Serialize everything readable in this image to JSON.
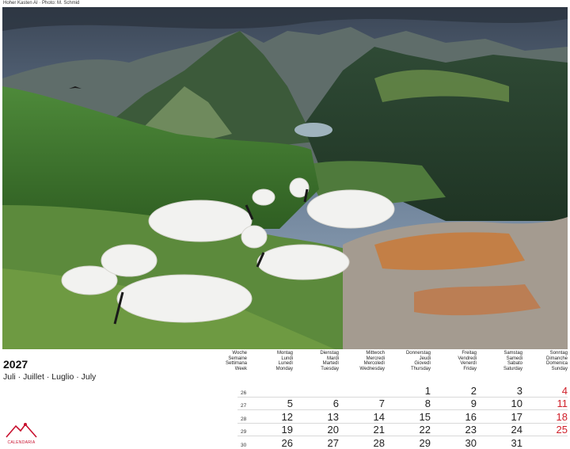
{
  "caption": "Hoher Kasten AI · Photo: M. Schmid",
  "year": "2027",
  "month": "Juli · Juillet · Luglio · July",
  "logo": "CALENDARIA",
  "weekHeader": [
    "Woche",
    "Semaine",
    "Settimana",
    "Week"
  ],
  "dayHeaders": [
    [
      "Montag",
      "Lundi",
      "Lunedì",
      "Monday"
    ],
    [
      "Dienstag",
      "Mardi",
      "Martedì",
      "Tuesday"
    ],
    [
      "Mittwoch",
      "Mercredi",
      "Mercoledì",
      "Wednesday"
    ],
    [
      "Donnerstag",
      "Jeudi",
      "Giovedì",
      "Thursday"
    ],
    [
      "Freitag",
      "Vendredi",
      "Venerdì",
      "Friday"
    ],
    [
      "Samstag",
      "Samedi",
      "Sabato",
      "Saturday"
    ],
    [
      "Sonntag",
      "Dimanche",
      "Domenica",
      "Sunday"
    ]
  ],
  "weeks": [
    {
      "week": "26",
      "days": [
        "",
        "",
        "",
        "1",
        "2",
        "3",
        "4"
      ]
    },
    {
      "week": "27",
      "days": [
        "5",
        "6",
        "7",
        "8",
        "9",
        "10",
        "11"
      ]
    },
    {
      "week": "28",
      "days": [
        "12",
        "13",
        "14",
        "15",
        "16",
        "17",
        "18"
      ]
    },
    {
      "week": "29",
      "days": [
        "19",
        "20",
        "21",
        "22",
        "23",
        "24",
        "25"
      ]
    },
    {
      "week": "30",
      "days": [
        "26",
        "27",
        "28",
        "29",
        "30",
        "31",
        ""
      ]
    }
  ],
  "colors": {
    "sunday": "#d0202a",
    "rule": "#d9d9d9"
  }
}
